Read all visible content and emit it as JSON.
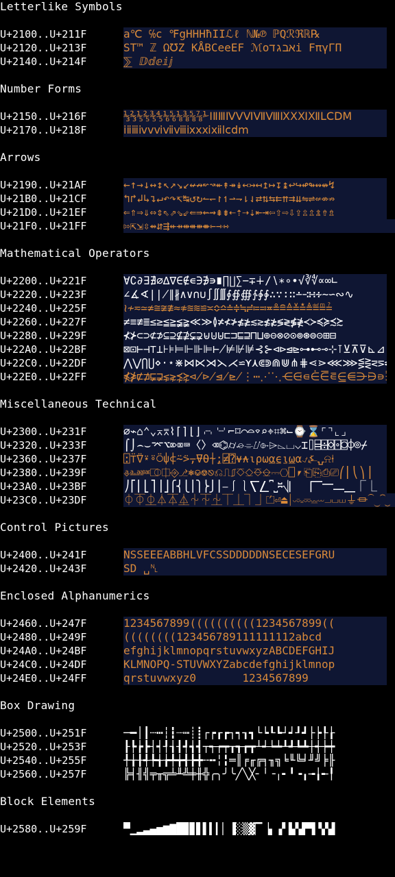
{
  "sections": [
    {
      "title": "Letterlike Symbols",
      "rows": [
        {
          "range": "U+2100..U+211F",
          "glyphs": "a℃ ℅c ℉gHHHħIIℒℓ ℕ№℗ ℙQℛℜℝ℞"
        },
        {
          "range": "U+2120..U+213F",
          "glyphs": "ST™ ℤ Ω℧Z KÅBCeeEF ℳoאבגדi FπγΓΠ"
        },
        {
          "range": "U+2140..U+214F",
          "glyphs": "⅀ ⅅⅆⅇⅈⅉ"
        }
      ]
    },
    {
      "title": "Number Forms",
      "rows": [
        {
          "range": "U+2150..U+216F",
          "glyphs": "⅓⅔⅕⅖⅗⅘⅙⅚⅛⅜⅝⅞⅟ⅠⅡⅢⅣⅤⅥⅦⅧⅨⅩⅪⅫⅬⅭⅮⅯ"
        },
        {
          "range": "U+2170..U+218F",
          "glyphs": "ⅰⅱⅲⅳⅴⅵⅶⅷⅸⅹⅺⅻⅼⅽⅾⅿ"
        }
      ]
    },
    {
      "title": "Arrows",
      "rows": [
        {
          "range": "U+2190..U+21AF",
          "glyphs": "←↑→↓↔↕↖↗↘↙↚↛↜↝↞↟↠↡↢↣↤↥↦↧↨↩↪↫↬↭↮↯"
        },
        {
          "range": "U+21B0..U+21CF",
          "glyphs": "↰↱↲↳↴↵↶↷↸↹↺↻↼↽↾↿⇀⇁⇂⇃⇄⇅⇆⇇⇈⇉⇊⇋⇌⇍⇎⇏"
        },
        {
          "range": "U+21D0..U+21EF",
          "glyphs": "⇐⇑⇒⇓⇔⇕⇖⇗⇘⇙⇚⇛⇜⇝⇞⇟⇠⇡⇢⇣⇤⇥⇦⇧⇨⇩⇪⇫⇬⇭⇮⇯"
        },
        {
          "range": "U+21F0..U+21FF",
          "glyphs": "⇰⇱⇲⇳⇴⇵⇶⇷⇸⇹⇺⇻⇼⇽⇾⇿"
        }
      ]
    },
    {
      "title": "Mathematical Operators",
      "rows": [
        {
          "range": "U+2200..U+221F",
          "glyphs": "∀∁∂∃∄∅∆∇∈∉∊∋∌∍∎∏∐∑−∓∔∕∖∗∘∙√∛∜∝∞∟"
        },
        {
          "range": "U+2220..U+223F",
          "glyphs": "∠∡∢∣∤∥∦∧∨∩∪∫∬∭∮∯∰∱∲∳∴∵∶∷∸∹∺∻∼∽∾∿"
        },
        {
          "range": "U+2240..U+225F",
          "glyphs": "≀≁≂≃≄≅≆≇≈≉≊≋≌≍≎≏≐≑≒≓≔≕≖≗≘≙≚≛≜≝≞≟"
        },
        {
          "range": "U+2260..U+227F",
          "glyphs": "≠≡≢≣≤≥≦≧≨≩≪≫≬≭≮≯≰≱≲≳≴≵≶≷≸≹≺≻≼≽≾≿"
        },
        {
          "range": "U+2280..U+229F",
          "glyphs": "⊀⊁⊂⊃⊄⊅⊆⊇⊈⊉⊊⊋⊌⊍⊎⊏⊐⊑⊒⊓⊔⊕⊖⊗⊘⊙⊚⊛⊜⊝⊞⊟"
        },
        {
          "range": "U+22A0..U+22BF",
          "glyphs": "⊠⊡⊢⊣⊤⊥⊦⊧⊨⊩⊪⊫⊬⊭⊮⊯⊰⊱⊲⊳⊴⊵⊶⊷⊸⊹⊺⊻⊼⊽⊾⊿"
        },
        {
          "range": "U+22C0..U+22DF",
          "glyphs": "⋀⋁⋂⋃⋄⋅⋆⋇⋈⋉⋊⋋⋌⋍⋎⋏⋐⋑⋒⋓⋔⋕⋖⋗⋘⋙⋚⋛⋜⋝⋞⋟"
        },
        {
          "range": "U+22E0..U+22FF",
          "glyphs": "⋠⋡⋢⋣⋤⋥⋦⋧⋨⋩⋪⋫⋬⋭⋮⋯⋰⋱⋲⋳⋴⋵⋶⋷⋸⋹⋺⋻⋼⋽⋾⋿"
        }
      ]
    },
    {
      "title": "Miscellaneous Technical",
      "rows": [
        {
          "range": "U+2300..U+231F",
          "glyphs": "⌀⌁⌂⌃⌄⌅⌆⌇⌈⌉⌊⌋⌌⌍⌎⌏⌐⌑⌒⌓⌔⌕⌖⌗⌘⌙⌚⌛⌜⌝⌞⌟"
        },
        {
          "range": "U+2320..U+233F",
          "glyphs": "⌠⌡⌢⌣⌤⌥⌦⌧⌨〈〉⌫⌬⌭⌮⌯⌰⌱⌲⌳⌴⌵⌶⌷⌸⌹⌺⌻⌼⌽⌾⌿"
        },
        {
          "range": "U+2360..U+237F",
          "glyphs": "⍠⍡⍢⍣⍤⍥⍦⍧⍨⍩⍪⍫⍬⍭⍮⍯⍰⍱⍲⍳⍴⍵⍶⍷⍸⍹⍺⍻⍼⍽⍾⍿"
        },
        {
          "range": "U+2380..U+239F",
          "glyphs": "⎀⎁⎂⎃⎄⎅⎆⎇⎈⎉⎊⎋⎌⎍⎎⎏⎐⎑⎒⎓⎔⎕⎖⎗⎘⎙⎚⎛⎜⎝⎞⎟"
        },
        {
          "range": "U+23A0..U+23BF",
          "glyphs": "⎠⎡⎢⎣⎤⎥⎦⎧⎨⎩⎪⎫⎬⎭⎮⎯⎰⎱⎲⎳⎴⎵⎶⎷⎸⎹⎺⎻⎼⎽⎾⎿"
        },
        {
          "range": "U+23C0..U+23DF",
          "glyphs": "⏀⏁⏂⏃⏄⏅⏆⏇⏈⏉⏊⏋⏌⏍⏎⏏⏐⏑⏒⏓⏔⏕⏖⏗⏘⏙⏚⏛⏜⏝⏞⏟"
        }
      ]
    },
    {
      "title": "Control Pictures",
      "rows": [
        {
          "range": "U+2400..U+241F",
          "glyphs": "NSSEEEABBHLVFCSSDDDDDNSECESEFGRU"
        },
        {
          "range": "U+2420..U+243F",
          "glyphs": "SD ␣␤"
        }
      ]
    },
    {
      "title": "Enclosed Alphanumerics",
      "rows": [
        {
          "range": "U+2460..U+247F",
          "glyphs": "1234567899((((((((((1234567899(("
        },
        {
          "range": "U+2480..U+249F",
          "glyphs": "((((((((123456789111111112abcd"
        },
        {
          "range": "U+24A0..U+24BF",
          "glyphs": "efghijklmnopqrstuvwxyzABCDEFGHIJ"
        },
        {
          "range": "U+24C0..U+24DF",
          "glyphs": "KLMNOPQ-STUVWXYZabcdefghijklmnop"
        },
        {
          "range": "U+24E0..U+24FF",
          "glyphs": "qrstuvwxyz0       1234567899"
        }
      ]
    },
    {
      "title": "Box Drawing",
      "rows": [
        {
          "range": "U+2500..U+251F",
          "glyphs": "─━│┃┄┅┆┇┈┉┊┋┌┍┎┏┐┑┒┓└┕┖┗┘┙┚┛├┝┞┟"
        },
        {
          "range": "U+2520..U+253F",
          "glyphs": "┠┡┢┣┤┥┦┧┨┩┪┫┬┭┮┯┰┱┲┳┴┵┶┷┸┹┺┻┼┽┾┿"
        },
        {
          "range": "U+2540..U+255F",
          "glyphs": "╀╁╂╃╄╅╆╇╈╉╊╋╌╍╎╏═║╒╓╔╕╖╗╘╙╚╛╜╝╞╟"
        },
        {
          "range": "U+2560..U+257F",
          "glyphs": "╠╡╢╣╤╥╦╧╨╩╪╫╬╭╮╯╰╱╲╳╴╵╶╷╸╹╺╻╼╽╾╿"
        }
      ]
    },
    {
      "title": "Block Elements",
      "rows": [
        {
          "range": "U+2580..U+259F",
          "glyphs": "▀▁▂▃▄▅▆▇█▉▊▋▌▍▎▏▐░▒▓▔▕▖▗▘▙▚▛▜▝▞▟"
        }
      ]
    }
  ]
}
